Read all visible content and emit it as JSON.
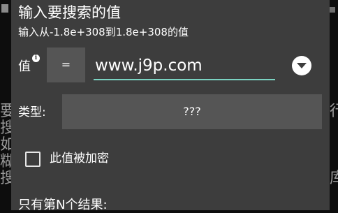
{
  "dialog": {
    "title": "输入要搜索的值",
    "subtitle": "输入从-1.8e+308到1.8e+308的值",
    "value_label": "值",
    "info_mark": "i",
    "operator": "=",
    "value_input": "www.j9p.com",
    "type_label": "类型:",
    "type_value": "???",
    "encrypted_label": "此值被加密",
    "encrypted_checked": false,
    "nth_result_label": "只有第N个结果:"
  },
  "background": {
    "left_chars": [
      "要",
      "搜",
      "如",
      "糊",
      "搜"
    ],
    "right_chars": [
      "行",
      "",
      "",
      "",
      "库"
    ]
  },
  "colors": {
    "dialog_bg": "#3d3d3d",
    "field_bg": "#555555",
    "accent_underline": "#7bd3c2"
  }
}
